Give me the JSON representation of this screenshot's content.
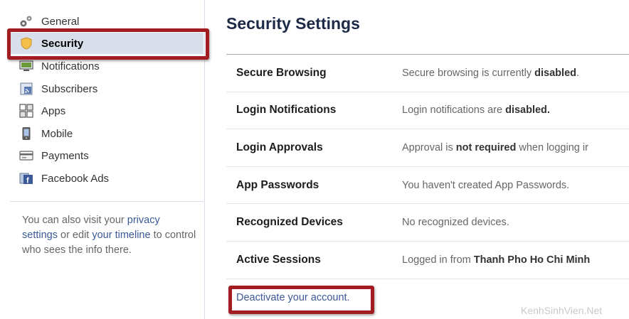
{
  "sidebar": {
    "items": [
      {
        "label": "General",
        "icon": "gears-icon"
      },
      {
        "label": "Security",
        "icon": "shield-icon",
        "active": true
      },
      {
        "label": "Notifications",
        "icon": "monitor-icon"
      },
      {
        "label": "Subscribers",
        "icon": "rss-icon"
      },
      {
        "label": "Apps",
        "icon": "puzzle-icon"
      },
      {
        "label": "Mobile",
        "icon": "phone-icon"
      },
      {
        "label": "Payments",
        "icon": "card-icon"
      },
      {
        "label": "Facebook Ads",
        "icon": "facebook-ads-icon"
      }
    ],
    "note": {
      "prefix": "You can also visit your ",
      "link1": "privacy settings",
      "middle": " or edit ",
      "link2": "your timeline",
      "suffix": " to control who sees the info there."
    }
  },
  "main": {
    "title": "Security Settings",
    "rows": [
      {
        "label": "Secure Browsing",
        "value_pre": "Secure browsing is currently ",
        "value_bold": "disabled",
        "value_post": "."
      },
      {
        "label": "Login Notifications",
        "value_pre": "Login notifications are ",
        "value_bold": "disabled.",
        "value_post": ""
      },
      {
        "label": "Login Approvals",
        "value_pre": "Approval is ",
        "value_bold": "not required",
        "value_post": " when logging ir"
      },
      {
        "label": "App Passwords",
        "value_pre": "You haven't created App Passwords.",
        "value_bold": "",
        "value_post": ""
      },
      {
        "label": "Recognized Devices",
        "value_pre": "No recognized devices.",
        "value_bold": "",
        "value_post": ""
      },
      {
        "label": "Active Sessions",
        "value_pre": "Logged in from ",
        "value_bold": "Thanh Pho Ho Chi Minh",
        "value_post": ""
      }
    ],
    "deactivate_link": "Deactivate your account."
  },
  "watermark": "KenhSinhVien.Net",
  "colors": {
    "highlight": "#a31c22",
    "link": "#3b5998",
    "active_bg": "#d8dfea"
  }
}
